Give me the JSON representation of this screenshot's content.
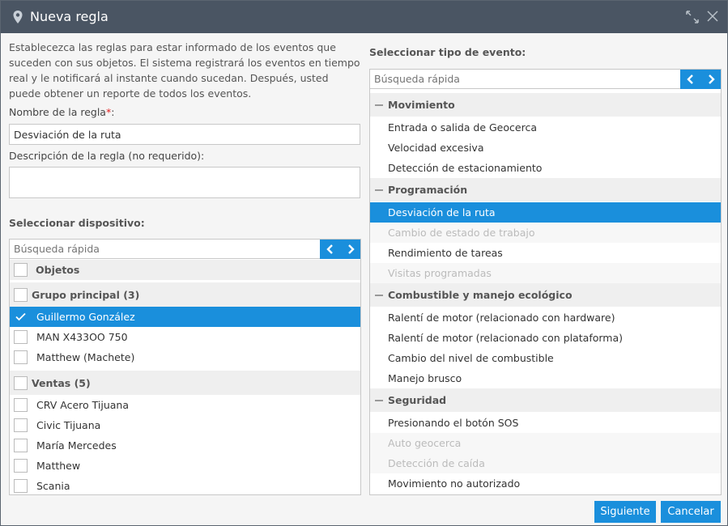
{
  "window": {
    "title": "Nueva regla",
    "icons": {
      "title": "map-pin-icon",
      "maximize": "maximize-icon",
      "close": "close-icon"
    }
  },
  "intro": "Establecezca las reglas para estar informado de los eventos que suceden con sus objetos. El sistema registrará los eventos en tiempo real y le notificará al instante cuando sucedan. Después, usted puede obtener un reporte de todos los eventos.",
  "form": {
    "name_label": "Nombre de la regla",
    "required_mark": "*",
    "name_value": "Desviación de la ruta",
    "description_label": "Descripción de la regla (no requerido):",
    "description_value": ""
  },
  "devices": {
    "title": "Seleccionar dispositivo:",
    "search_placeholder": "Búsqueda rápida",
    "header_label": "Objetos",
    "groups": [
      {
        "label": "Grupo principal (3)",
        "items": [
          {
            "label": "Guillermo González",
            "checked": true
          },
          {
            "label": "MAN X433OO 750",
            "checked": false
          },
          {
            "label": "Matthew (Machete)",
            "checked": false
          }
        ]
      },
      {
        "label": "Ventas (5)",
        "items": [
          {
            "label": "CRV Acero Tijuana",
            "checked": false
          },
          {
            "label": "Civic Tijuana",
            "checked": false
          },
          {
            "label": "María Mercedes",
            "checked": false
          },
          {
            "label": "Matthew",
            "checked": false
          },
          {
            "label": "Scania",
            "checked": false
          }
        ]
      }
    ]
  },
  "events": {
    "title": "Seleccionar tipo de evento:",
    "search_placeholder": "Búsqueda rápida",
    "groups": [
      {
        "label": "Movimiento",
        "items": [
          {
            "label": "Entrada o salida de Geocerca",
            "state": "normal"
          },
          {
            "label": "Velocidad excesiva",
            "state": "normal"
          },
          {
            "label": "Detección de estacionamiento",
            "state": "normal"
          }
        ]
      },
      {
        "label": "Programación",
        "items": [
          {
            "label": "Desviación de la ruta",
            "state": "selected"
          },
          {
            "label": "Cambio de estado de trabajo",
            "state": "disabled"
          },
          {
            "label": "Rendimiento de tareas",
            "state": "normal"
          },
          {
            "label": "Visitas programadas",
            "state": "disabled"
          }
        ]
      },
      {
        "label": "Combustible y manejo ecológico",
        "items": [
          {
            "label": "Ralentí de motor (relacionado con hardware)",
            "state": "normal"
          },
          {
            "label": "Ralentí de motor (relacionado con plataforma)",
            "state": "normal"
          },
          {
            "label": "Cambio del nivel de combustible",
            "state": "normal"
          },
          {
            "label": "Manejo brusco",
            "state": "normal"
          }
        ]
      },
      {
        "label": "Seguridad",
        "items": [
          {
            "label": "Presionando el botón SOS",
            "state": "normal"
          },
          {
            "label": "Auto geocerca",
            "state": "disabled"
          },
          {
            "label": "Detección de caída",
            "state": "disabled"
          },
          {
            "label": "Movimiento no autorizado",
            "state": "normal"
          }
        ]
      }
    ]
  },
  "buttons": {
    "next": "Siguiente",
    "cancel": "Cancelar"
  },
  "colors": {
    "titlebar": "#4a5563",
    "accent": "#1a8fdc",
    "group_bg": "#efefef",
    "disabled_text": "#bbbbbb"
  }
}
